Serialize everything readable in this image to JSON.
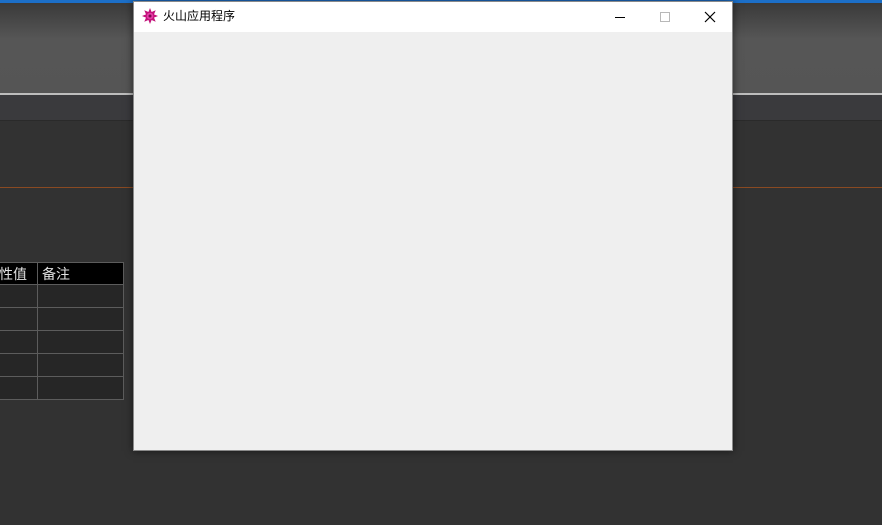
{
  "window": {
    "title": "火山应用程序",
    "icon": "volcano-app-icon",
    "controls": [
      "minimize-icon",
      "maximize-icon",
      "close-icon"
    ]
  },
  "background": {
    "property_table": {
      "headers": [
        "性值",
        "备注"
      ],
      "rows": 5
    }
  },
  "colors": {
    "window_client": "#efefef",
    "titlebar": "#ffffff",
    "ide_background": "#333333",
    "accent_line": "#8a4a22",
    "icon_magenta": "#c2127a"
  }
}
